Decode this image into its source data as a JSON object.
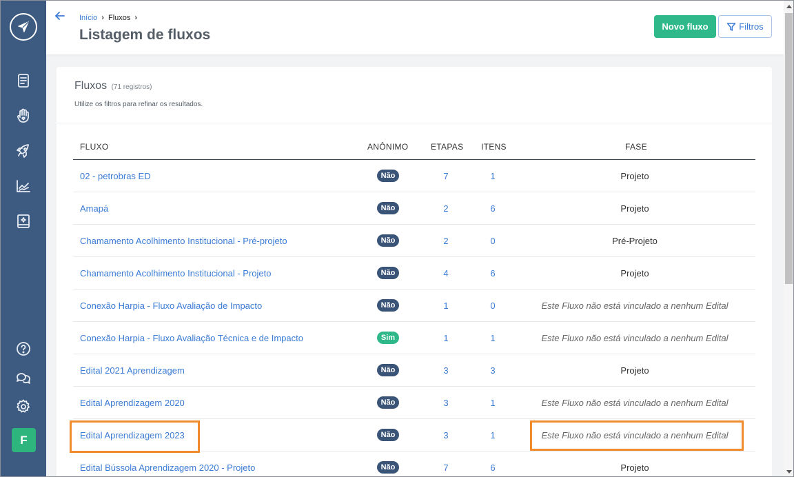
{
  "header": {
    "breadcrumb": [
      {
        "label": "Início"
      },
      {
        "label": "Fluxos"
      }
    ],
    "title": "Listagem de fluxos",
    "new_button": "Novo fluxo",
    "filter_button": "Filtros"
  },
  "sidebar": {
    "icons": [
      "logo-send-icon",
      "document-icon",
      "hand-heart-icon",
      "rocket-icon",
      "chart-line-icon",
      "book-sparkle-icon",
      "help-icon",
      "chat-icon",
      "settings-icon"
    ],
    "avatar_letter": "F"
  },
  "card": {
    "title": "Fluxos",
    "count": "(71 registros)",
    "hint": "Utilize os filtros para refinar os resultados."
  },
  "table": {
    "columns": {
      "name": "FLUXO",
      "anon": "ANÔNIMO",
      "steps": "ETAPAS",
      "items": "ITENS",
      "phase": "FASE"
    },
    "rows": [
      {
        "name": "02 - petrobras ED",
        "anon": "Não",
        "steps": "7",
        "items": "1",
        "phase": "Projeto"
      },
      {
        "name": "Amapá",
        "anon": "Não",
        "steps": "2",
        "items": "6",
        "phase": "Projeto"
      },
      {
        "name": "Chamamento Acolhimento Institucional - Pré-projeto",
        "anon": "Não",
        "steps": "2",
        "items": "0",
        "phase": "Pré-Projeto"
      },
      {
        "name": "Chamamento Acolhimento Institucional - Projeto",
        "anon": "Não",
        "steps": "4",
        "items": "6",
        "phase": "Projeto"
      },
      {
        "name": "Conexão Harpia - Fluxo Avaliação de Impacto",
        "anon": "Não",
        "steps": "1",
        "items": "0",
        "phase": "Este Fluxo não está vinculado a nenhum Edital"
      },
      {
        "name": "Conexão Harpia - Fluxo Avaliação Técnica e de Impacto",
        "anon": "Sim",
        "steps": "1",
        "items": "1",
        "phase": "Este Fluxo não está vinculado a nenhum Edital"
      },
      {
        "name": "Edital 2021 Aprendizagem",
        "anon": "Não",
        "steps": "3",
        "items": "3",
        "phase": "Projeto"
      },
      {
        "name": "Edital Aprendizagem 2020",
        "anon": "Não",
        "steps": "3",
        "items": "1",
        "phase": "Este Fluxo não está vinculado a nenhum Edital"
      },
      {
        "name": "Edital Aprendizagem 2023",
        "anon": "Não",
        "steps": "3",
        "items": "1",
        "phase": "Este Fluxo não está vinculado a nenhum Edital"
      },
      {
        "name": "Edital Bússola Aprendizagem 2020 - Projeto",
        "anon": "Não",
        "steps": "7",
        "items": "6",
        "phase": "Projeto"
      }
    ]
  },
  "colors": {
    "sidebar": "#3d5a80",
    "accent": "#3a7bd5",
    "primary_button": "#2fb88a",
    "badge_no": "#3a5478",
    "badge_yes": "#2fb88a",
    "highlight": "#f28a2e"
  }
}
